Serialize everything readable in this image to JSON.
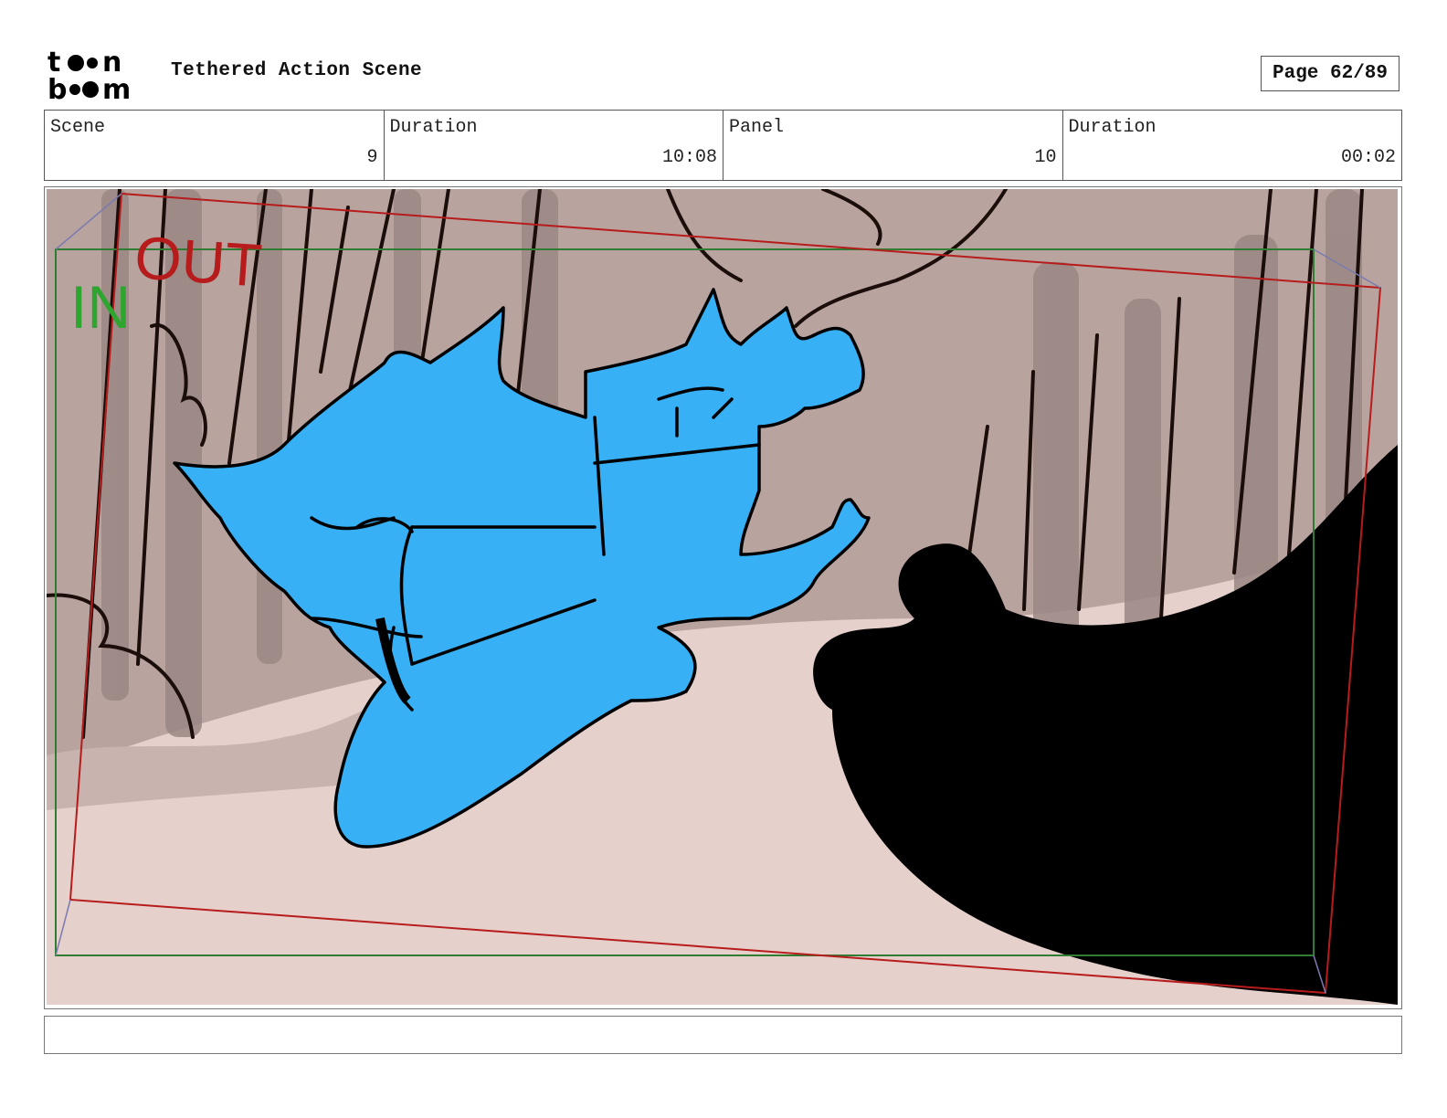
{
  "header": {
    "logo_text": "toon boom",
    "title": "Tethered Action Scene",
    "page": "Page 62/89"
  },
  "info": [
    {
      "label": "Scene",
      "value": "9"
    },
    {
      "label": "Duration",
      "value": "10:08"
    },
    {
      "label": "Panel",
      "value": "10"
    },
    {
      "label": "Duration",
      "value": "00:02"
    }
  ],
  "panel": {
    "in_label": "IN",
    "out_label": "OUT",
    "colors": {
      "in_frame": "#2e7d32",
      "out_frame": "#b71c1c",
      "character": "#38b0f5",
      "background": "#e6d0cc",
      "trees": "#a89590",
      "foreground": "#000000"
    }
  },
  "caption": ""
}
